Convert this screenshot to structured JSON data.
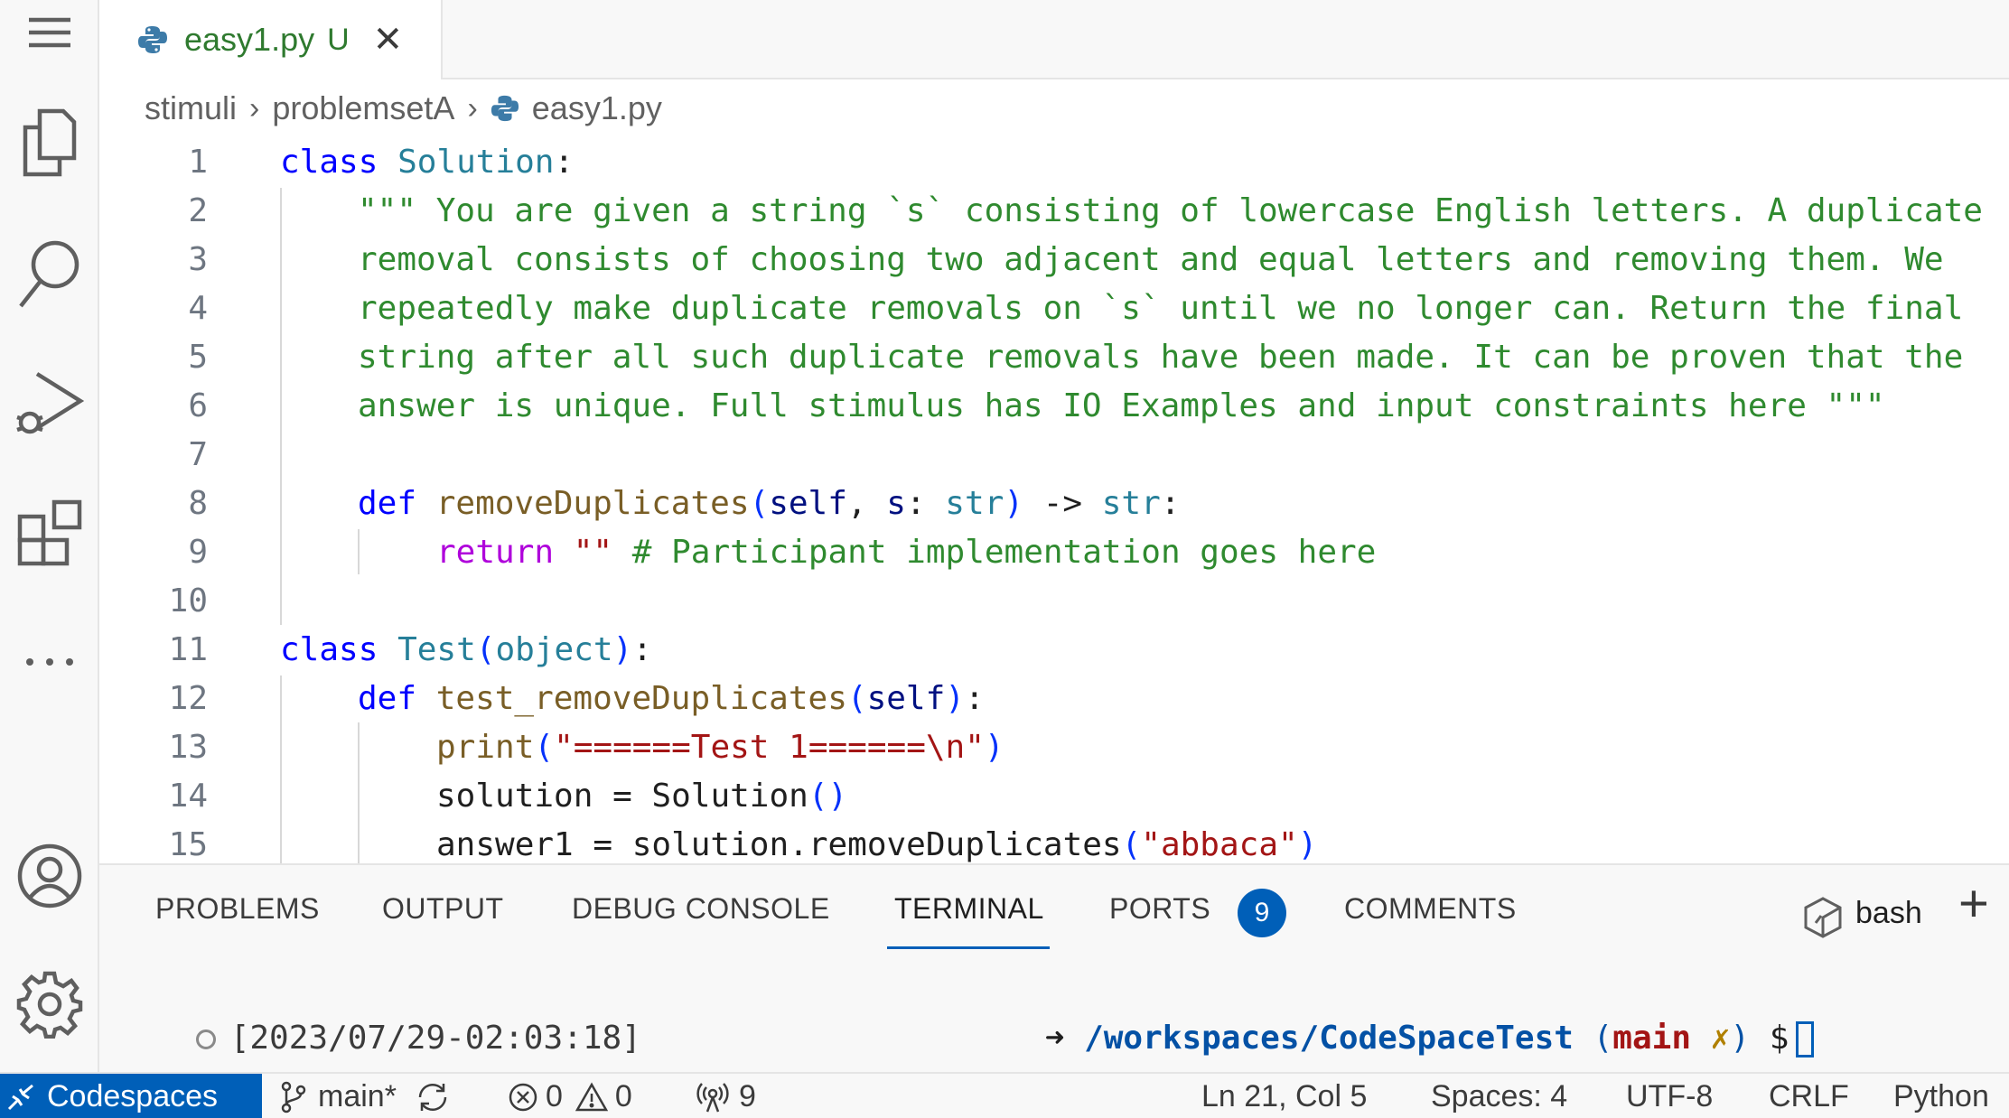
{
  "tab": {
    "filename": "easy1.py",
    "modified_marker": "U",
    "close_glyph": "✕"
  },
  "breadcrumb": {
    "items": [
      "stimuli",
      "problemsetA",
      "easy1.py"
    ]
  },
  "code": {
    "line_numbers": [
      "1",
      "2",
      "3",
      "4",
      "5",
      "6",
      "7",
      "8",
      "9",
      "10",
      "11",
      "12",
      "13",
      "14",
      "15"
    ],
    "l1": {
      "kw": "class",
      "name": "Solution",
      "colon": ":"
    },
    "l2": "\"\"\" You are given a string `s` consisting of lowercase English letters. A duplicate",
    "l3": "removal consists of choosing two adjacent and equal letters and removing them. We",
    "l4": "repeatedly make duplicate removals on `s` until we no longer can. Return the final",
    "l5": "string after all such duplicate removals have been made. It can be proven that the",
    "l6": "answer is unique. Full stimulus has IO Examples and input constraints here \"\"\"",
    "l8": {
      "kw": "def",
      "name": "removeDuplicates",
      "open": "(",
      "self": "self",
      "comma": ", ",
      "param": "s",
      "colon1": ": ",
      "type1": "str",
      "close": ")",
      "arrow": " -> ",
      "type2": "str",
      "colon2": ":"
    },
    "l9": {
      "kw": "return",
      "str": " \"\"",
      "comment": " # Participant implementation goes here"
    },
    "l11": {
      "kw": "class",
      "name": "Test",
      "open": "(",
      "base": "object",
      "close": ")",
      "colon": ":"
    },
    "l12": {
      "kw": "def",
      "name": "test_removeDuplicates",
      "open": "(",
      "self": "self",
      "close": ")",
      "colon": ":"
    },
    "l13": {
      "fn": "print",
      "open": "(",
      "str": "\"======Test 1======\\n\"",
      "close": ")"
    },
    "l14": {
      "var": "solution = ",
      "cls": "Solution",
      "parens": "()"
    },
    "l15": {
      "var": "answer1 = solution.",
      "fn": "removeDuplicates",
      "open": "(",
      "str": "\"abbaca\"",
      "close": ")"
    }
  },
  "panel": {
    "tabs": [
      "PROBLEMS",
      "OUTPUT",
      "DEBUG CONSOLE",
      "TERMINAL",
      "PORTS",
      "COMMENTS"
    ],
    "active_tab": "TERMINAL",
    "ports_badge": "9",
    "shell": "bash",
    "add_glyph": "+"
  },
  "terminal": {
    "timestamp": "[2023/07/29-02:03:18]",
    "arrow": "➜",
    "path": "/workspaces/CodeSpaceTest",
    "git_open": " (",
    "branch": "main",
    "dirty": " ✗",
    "git_close": ")",
    "prompt": " $"
  },
  "status": {
    "remote": "Codespaces",
    "branch": "main*",
    "errors": "0",
    "warnings": "0",
    "ports": "9",
    "position": "Ln 21, Col 5",
    "spaces": "Spaces: 4",
    "encoding": "UTF-8",
    "eol": "CRLF",
    "language": "Python"
  },
  "colors": {
    "accent": "#005fb8",
    "keyword": "#0000ff",
    "class": "#267f99",
    "function": "#795e26",
    "string": "#a31515",
    "comment": "#2f8a2f"
  }
}
